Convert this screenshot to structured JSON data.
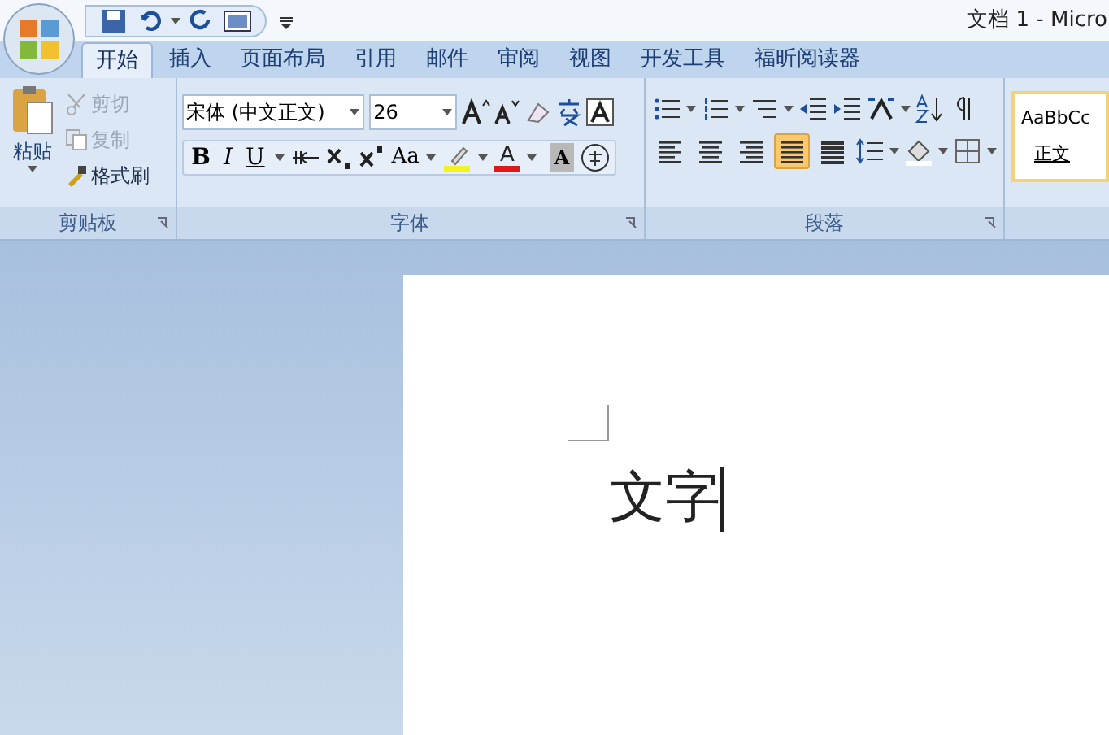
{
  "window": {
    "title": "文档 1 - Micro"
  },
  "tabs": [
    {
      "label": "开始",
      "selected": true
    },
    {
      "label": "插入",
      "selected": false
    },
    {
      "label": "页面布局",
      "selected": false
    },
    {
      "label": "引用",
      "selected": false
    },
    {
      "label": "邮件",
      "selected": false
    },
    {
      "label": "审阅",
      "selected": false
    },
    {
      "label": "视图",
      "selected": false
    },
    {
      "label": "开发工具",
      "selected": false
    },
    {
      "label": "福昕阅读器",
      "selected": false
    }
  ],
  "clipboard": {
    "label": "剪贴板",
    "paste": "粘贴",
    "items": [
      {
        "label": "剪切",
        "disabled": true,
        "kind": "cut"
      },
      {
        "label": "复制",
        "disabled": true,
        "kind": "copy"
      },
      {
        "label": "格式刷",
        "disabled": false,
        "kind": "brush"
      }
    ]
  },
  "font": {
    "label": "字体",
    "font_name": "宋体 (中文正文)",
    "font_size": "26",
    "bold": "B",
    "italic": "I",
    "underline": "U",
    "change_case": "Aa",
    "font_color_letter": "A",
    "shade_letter": "A"
  },
  "paragraph": {
    "label": "段落",
    "alignments": [
      {
        "kind": "left",
        "selected": false
      },
      {
        "kind": "center",
        "selected": false
      },
      {
        "kind": "right",
        "selected": false
      },
      {
        "kind": "justify",
        "selected": true
      },
      {
        "kind": "distributed",
        "selected": false
      }
    ]
  },
  "styles": {
    "preview": "AaBbCc",
    "name": "正文"
  },
  "document": {
    "text": "文字"
  }
}
